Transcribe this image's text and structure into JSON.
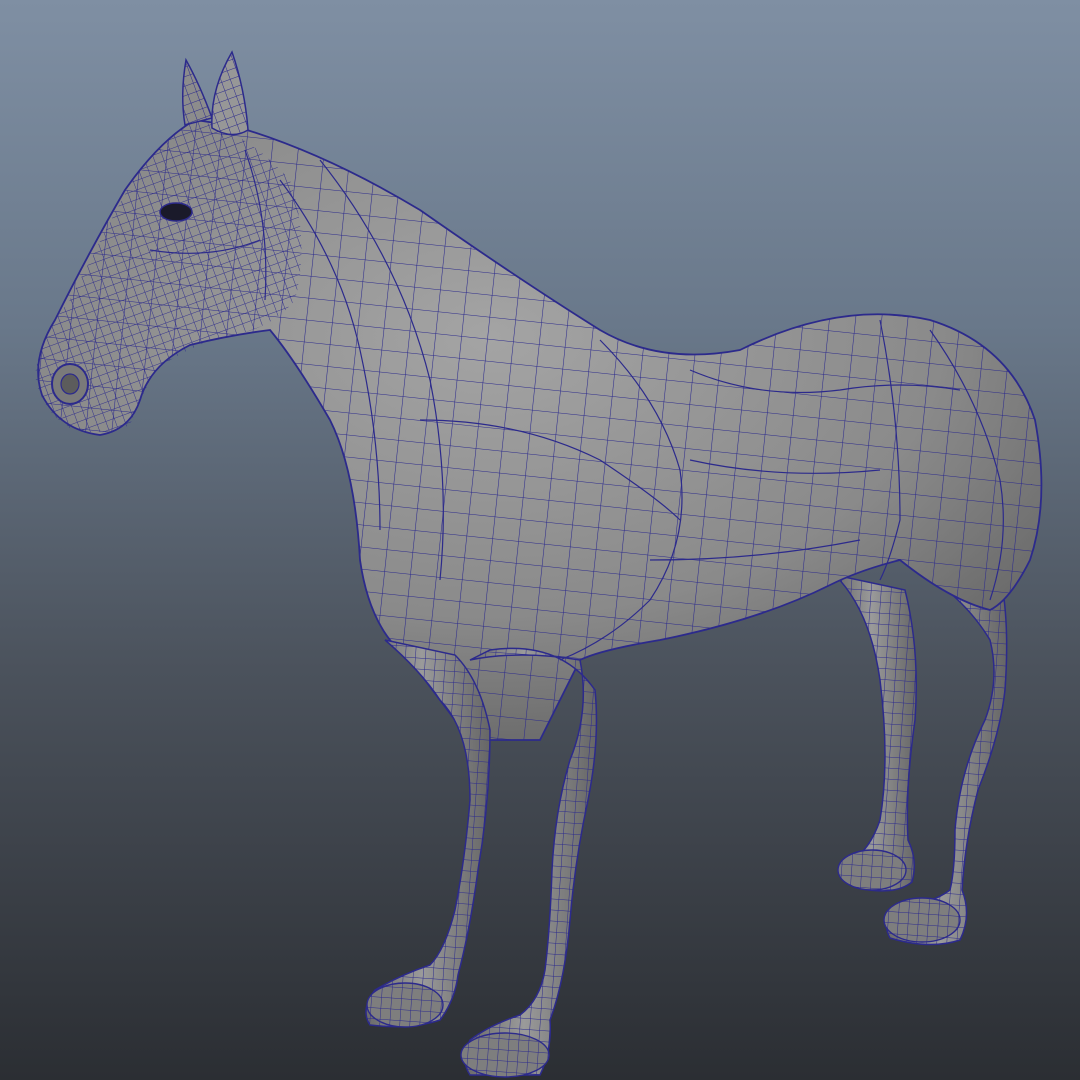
{
  "viewport": {
    "background_top": "#7f8fa3",
    "background_bottom": "#2b2e33"
  },
  "model": {
    "subject": "horse",
    "display": "wireframe-on-shaded",
    "surface_color": "#8d8d8d",
    "wire_color": "#2c2a8c"
  }
}
